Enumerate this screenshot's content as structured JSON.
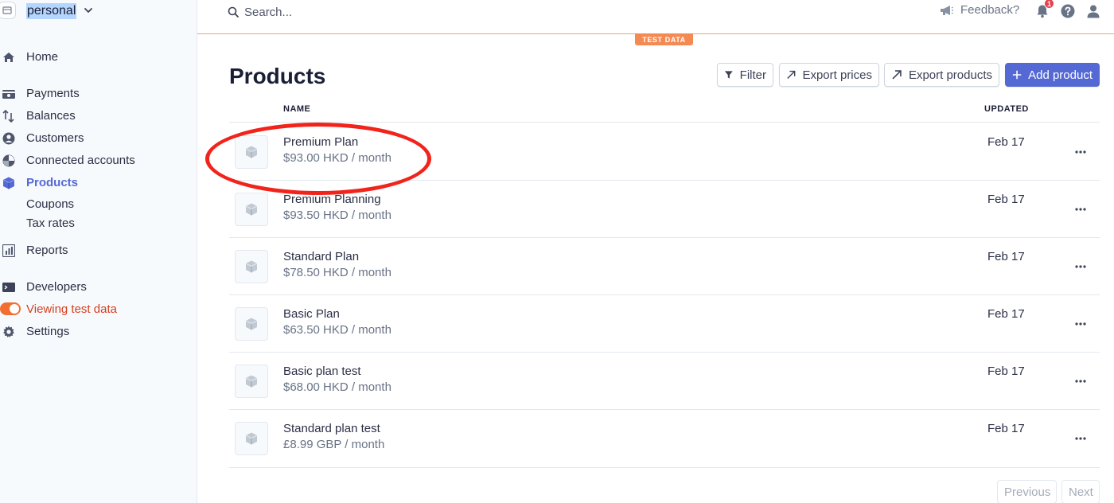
{
  "account": {
    "name": "personal"
  },
  "sidebar": {
    "items": [
      {
        "label": "Home",
        "icon": "home-icon"
      },
      {
        "label": "Payments",
        "icon": "payments-icon"
      },
      {
        "label": "Balances",
        "icon": "balances-icon"
      },
      {
        "label": "Customers",
        "icon": "customers-icon"
      },
      {
        "label": "Connected accounts",
        "icon": "connected-accounts-icon"
      },
      {
        "label": "Products",
        "icon": "products-icon",
        "active": true
      },
      {
        "label": "Reports",
        "icon": "reports-icon"
      },
      {
        "label": "Developers",
        "icon": "developers-icon"
      },
      {
        "label": "Viewing test data",
        "icon": "toggle-icon"
      },
      {
        "label": "Settings",
        "icon": "gear-icon"
      }
    ],
    "sub_items": [
      "Coupons",
      "Tax rates"
    ]
  },
  "topbar": {
    "search_placeholder": "Search...",
    "feedback_label": "Feedback?",
    "notification_count": "1"
  },
  "test_badge": "TEST DATA",
  "page": {
    "title": "Products",
    "buttons": {
      "filter": "Filter",
      "export_prices": "Export prices",
      "export_products": "Export products",
      "add_product": "Add product"
    }
  },
  "table": {
    "columns": {
      "name": "NAME",
      "updated": "UPDATED"
    },
    "rows": [
      {
        "name": "Premium Plan",
        "price": "$93.00 HKD / month",
        "updated": "Feb 17"
      },
      {
        "name": "Premium Planning",
        "price": "$93.50 HKD / month",
        "updated": "Feb 17"
      },
      {
        "name": "Standard Plan",
        "price": "$78.50 HKD / month",
        "updated": "Feb 17"
      },
      {
        "name": "Basic Plan",
        "price": "$63.50 HKD / month",
        "updated": "Feb 17"
      },
      {
        "name": "Basic plan test",
        "price": "$68.00 HKD / month",
        "updated": "Feb 17"
      },
      {
        "name": "Standard plan test",
        "price": "£8.99 GBP / month",
        "updated": "Feb 17"
      }
    ]
  },
  "pagination": {
    "previous": "Previous",
    "next": "Next"
  },
  "colors": {
    "accent": "#5469d4",
    "test_mode": "#f48a52",
    "annotation": "#f2231b"
  }
}
